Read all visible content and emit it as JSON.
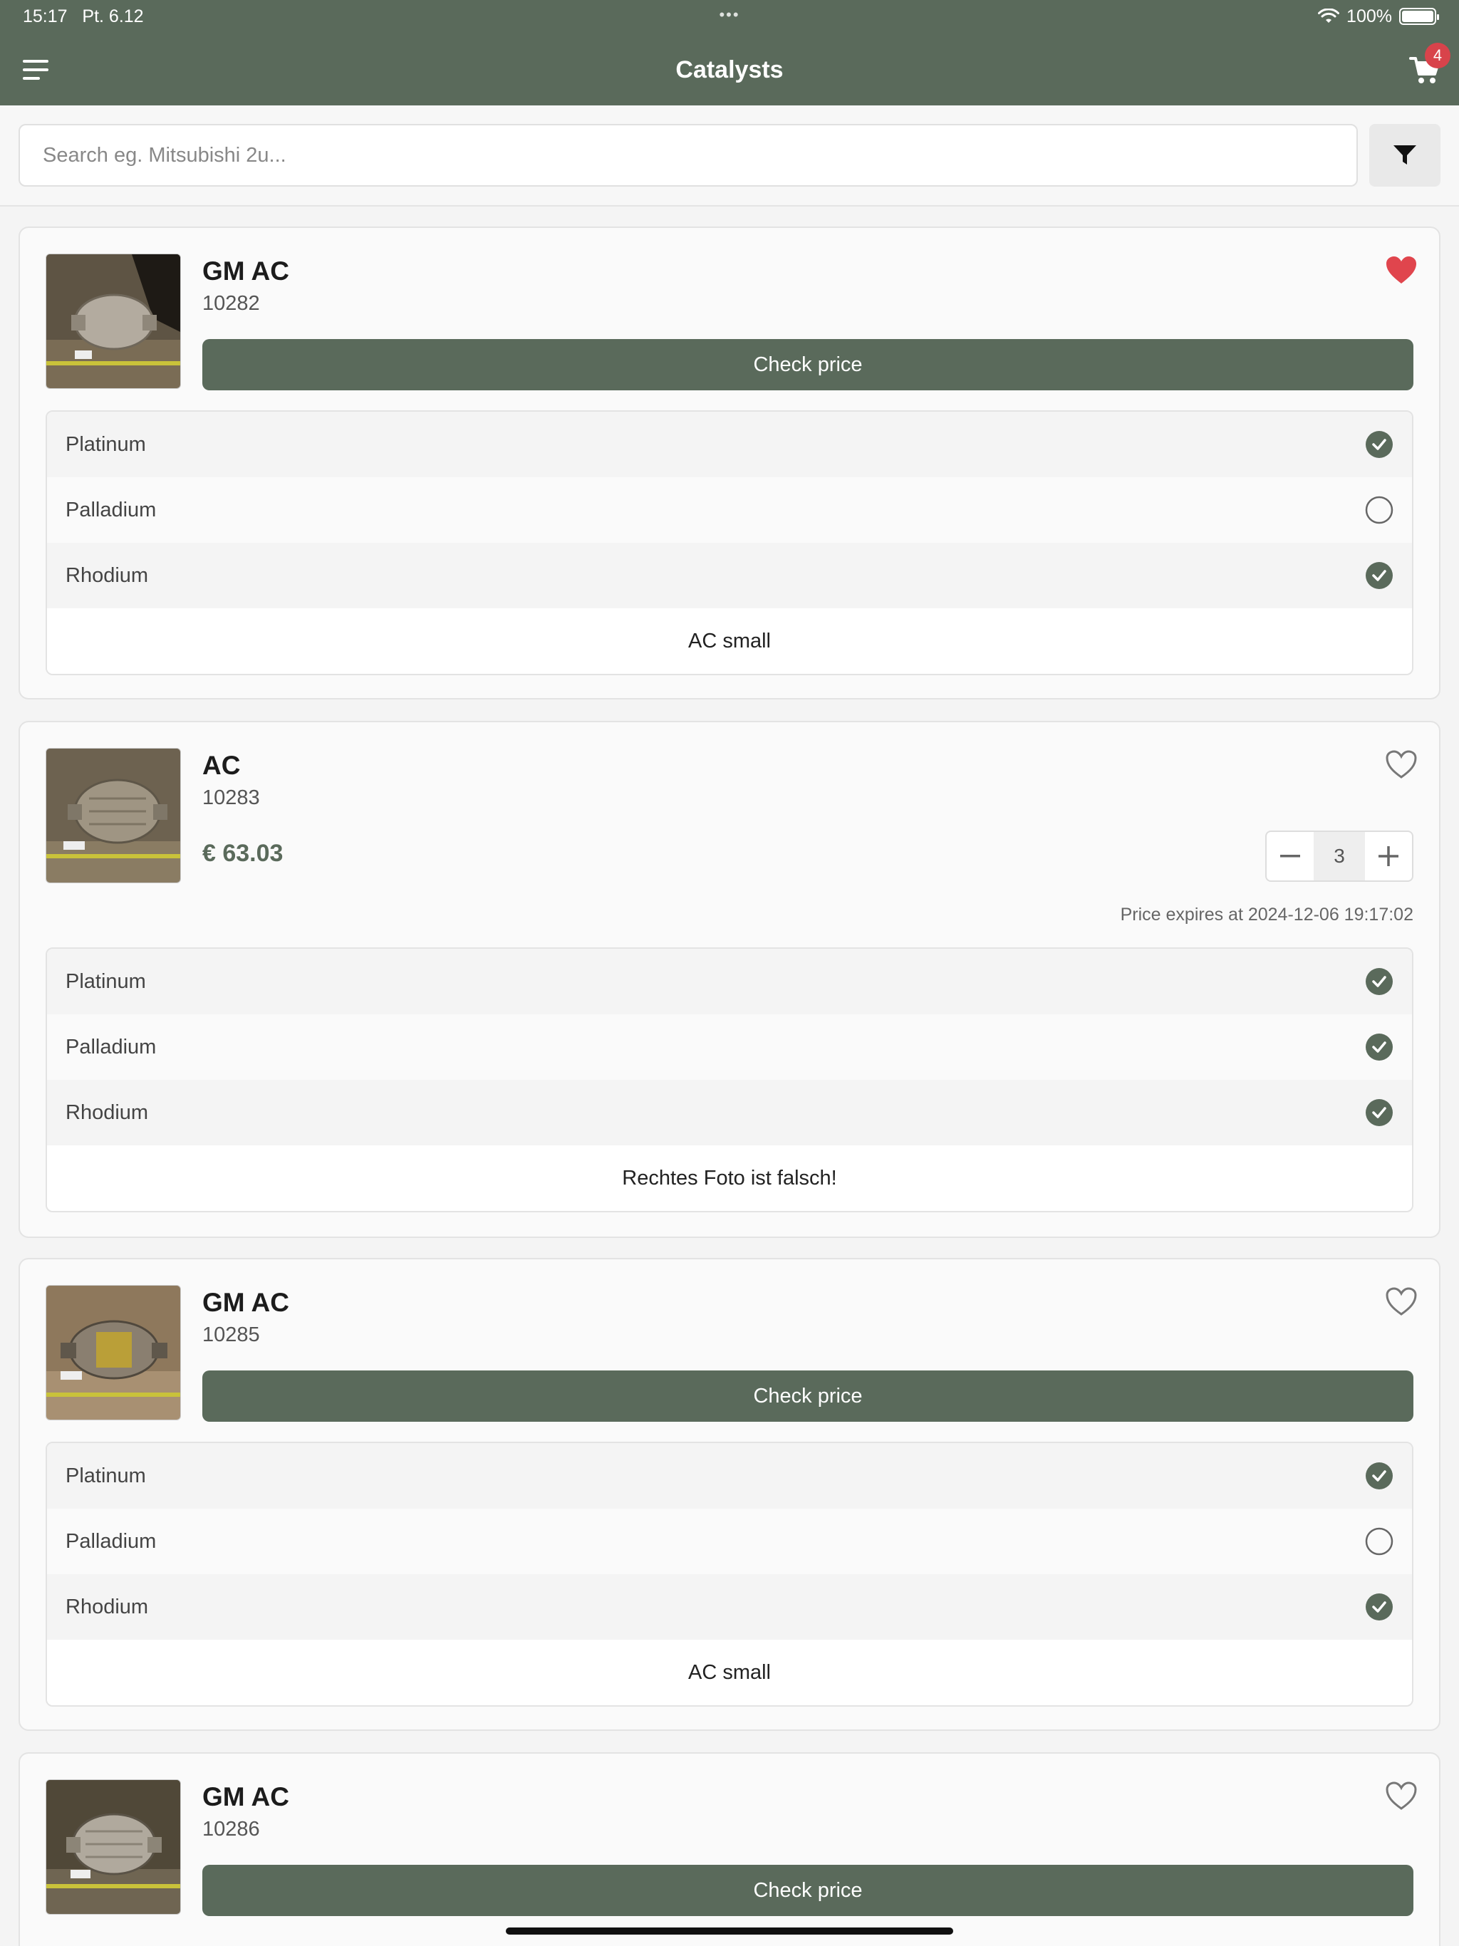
{
  "status_bar": {
    "time": "15:17",
    "date": "Pt. 6.12",
    "battery": "100%"
  },
  "header": {
    "title": "Catalysts",
    "cart_count": "4"
  },
  "search": {
    "placeholder": "Search eg. Mitsubishi 2u..."
  },
  "colors": {
    "primary": "#5a6a5b",
    "favorite": "#e0454d",
    "badge": "#d8434b"
  },
  "cards": [
    {
      "name": "GM AC",
      "code": "10282",
      "favorite": true,
      "check_price_label": "Check price",
      "metals": [
        {
          "label": "Platinum",
          "checked": true
        },
        {
          "label": "Palladium",
          "checked": false
        },
        {
          "label": "Rhodium",
          "checked": true
        }
      ],
      "note": "AC small"
    },
    {
      "name": "AC",
      "code": "10283",
      "favorite": false,
      "price": "€ 63.03",
      "quantity": "3",
      "expires": "Price expires at 2024-12-06 19:17:02",
      "metals": [
        {
          "label": "Platinum",
          "checked": true
        },
        {
          "label": "Palladium",
          "checked": true
        },
        {
          "label": "Rhodium",
          "checked": true
        }
      ],
      "note": "Rechtes Foto ist falsch!"
    },
    {
      "name": "GM AC",
      "code": "10285",
      "favorite": false,
      "check_price_label": "Check price",
      "metals": [
        {
          "label": "Platinum",
          "checked": true
        },
        {
          "label": "Palladium",
          "checked": false
        },
        {
          "label": "Rhodium",
          "checked": true
        }
      ],
      "note": "AC small"
    },
    {
      "name": "GM AC",
      "code": "10286",
      "favorite": false,
      "check_price_label": "Check price"
    }
  ]
}
